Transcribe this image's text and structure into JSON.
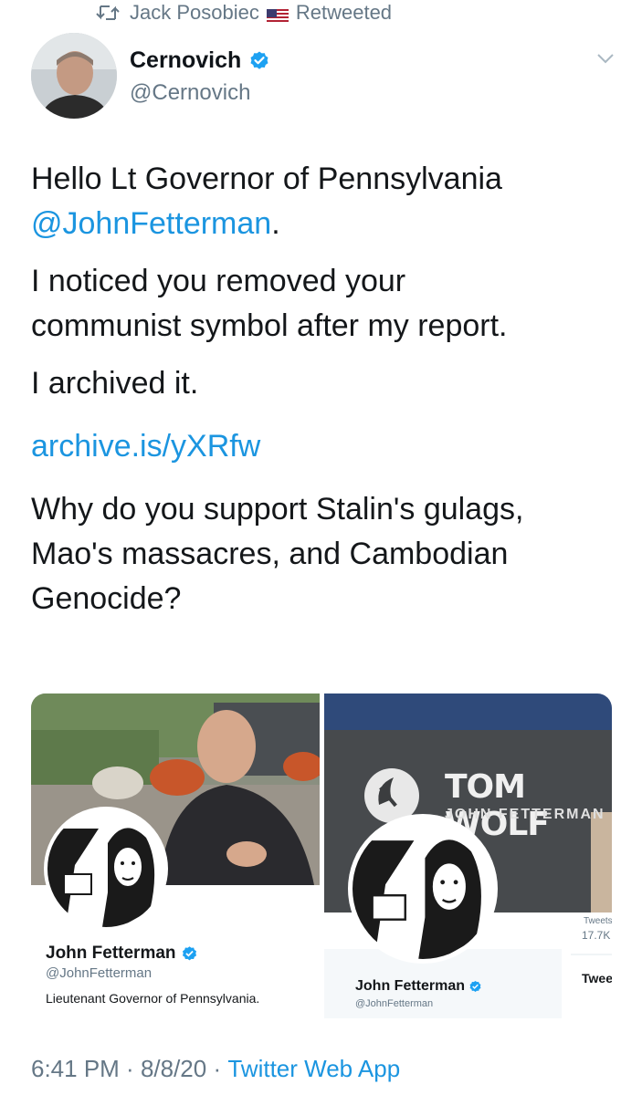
{
  "retweet": {
    "user": "Jack Posobiec",
    "label": "Retweeted"
  },
  "author": {
    "display_name": "Cernovich",
    "handle": "@Cernovich",
    "verified": true
  },
  "tweet": {
    "line1": "Hello Lt Governor of Pennsylvania",
    "mention": "@JohnFetterman",
    "mention_suffix": ".",
    "line2a": "I noticed you removed your",
    "line2b": "communist symbol after my report.",
    "line3": "I archived it.",
    "link": "archive.is/yXRfw",
    "line4a": "Why do you support Stalin's gulags,",
    "line4b": "Mao's massacres, and Cambodian",
    "line4c": "Genocide?"
  },
  "media": {
    "left": {
      "name": "John Fetterman",
      "handle": "@JohnFetterman",
      "bio": "Lieutenant Governor of Pennsylvania."
    },
    "right": {
      "banner_line1": "TOM WOLF",
      "banner_line2": "JOHN FETTERMAN",
      "name": "John Fetterman",
      "handle": "@JohnFetterman",
      "tweets_label": "Tweets",
      "tweets_count": "17.7K",
      "tab_label": "Tweets"
    }
  },
  "footer": {
    "time": "6:41 PM",
    "sep1": " · ",
    "date": "8/8/20",
    "sep2": " · ",
    "app": "Twitter Web App"
  },
  "colors": {
    "link": "#1b95e0",
    "muted": "#657786",
    "verified": "#1da1f2"
  }
}
